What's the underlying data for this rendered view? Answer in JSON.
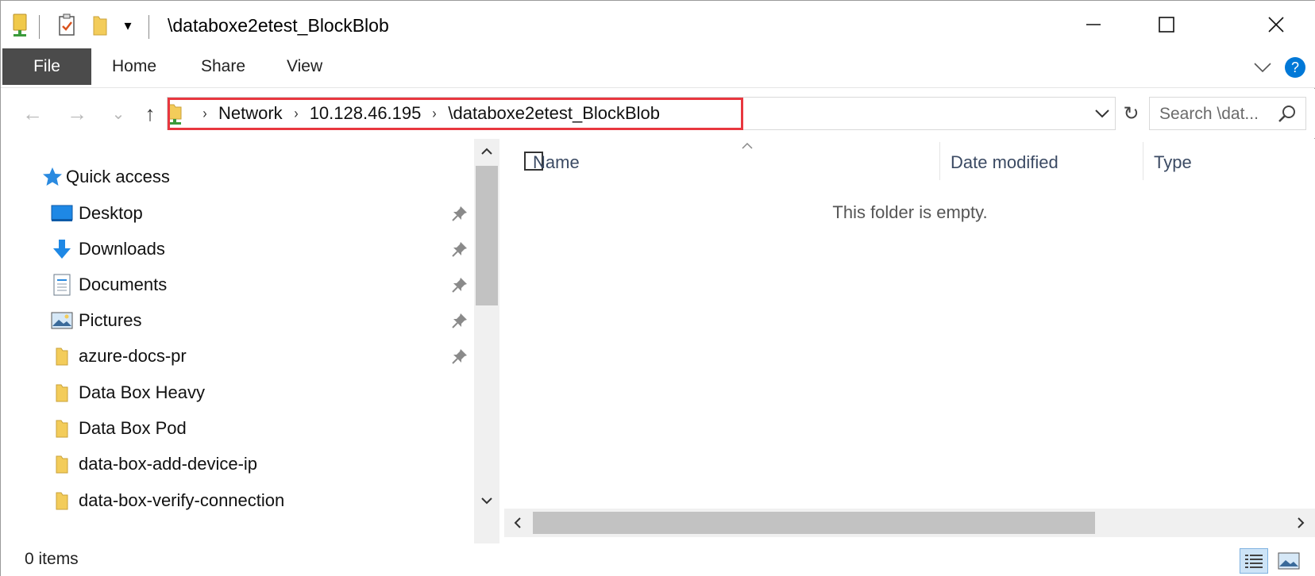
{
  "window": {
    "title": "\\databoxe2etest_BlockBlob",
    "minimize": "—",
    "maximize": "☐",
    "close": "✕"
  },
  "quick_access_toolbar": {
    "icons": [
      "network-drive-icon",
      "properties-icon",
      "new-folder-icon",
      "customize-dropdown-icon"
    ],
    "dropdown_glyph": "▾"
  },
  "ribbon": {
    "tabs": [
      {
        "label": "File",
        "active": true
      },
      {
        "label": "Home"
      },
      {
        "label": "Share"
      },
      {
        "label": "View"
      }
    ],
    "collapse_glyph": "∨",
    "help_glyph": "?"
  },
  "navigation": {
    "back": "←",
    "forward": "→",
    "recent": "⌄",
    "up": "↑"
  },
  "address": {
    "crumbs": [
      "Network",
      "10.128.46.195",
      "\\databoxe2etest_BlockBlob"
    ],
    "separator": "›",
    "dropdown": "⌄",
    "refresh": "↻",
    "highlight_color": "#e8373f"
  },
  "search": {
    "placeholder": "Search \\dat..."
  },
  "nav_pane": {
    "quick_access_label": "Quick access",
    "items": [
      {
        "label": "Desktop",
        "icon": "desktop-icon",
        "pinned": true
      },
      {
        "label": "Downloads",
        "icon": "downloads-icon",
        "pinned": true
      },
      {
        "label": "Documents",
        "icon": "documents-icon",
        "pinned": true
      },
      {
        "label": "Pictures",
        "icon": "pictures-icon",
        "pinned": true
      },
      {
        "label": "azure-docs-pr",
        "icon": "folder-icon",
        "pinned": true
      },
      {
        "label": "Data Box Heavy",
        "icon": "folder-icon",
        "pinned": false
      },
      {
        "label": "Data Box Pod",
        "icon": "folder-icon",
        "pinned": false
      },
      {
        "label": "data-box-add-device-ip",
        "icon": "folder-icon",
        "pinned": false
      },
      {
        "label": "data-box-verify-connection",
        "icon": "folder-icon",
        "pinned": false
      }
    ],
    "scroll_up": "^",
    "scroll_down": "v"
  },
  "content": {
    "columns": [
      "Name",
      "Date modified",
      "Type"
    ],
    "sort_glyph": "^",
    "empty_message": "This folder is empty.",
    "scroll_left": "<",
    "scroll_right": ">"
  },
  "status": {
    "item_count": "0 items"
  },
  "colors": {
    "accent": "#0078d7",
    "file_tab": "#4b4b4b",
    "folder": "#e8c04a"
  }
}
